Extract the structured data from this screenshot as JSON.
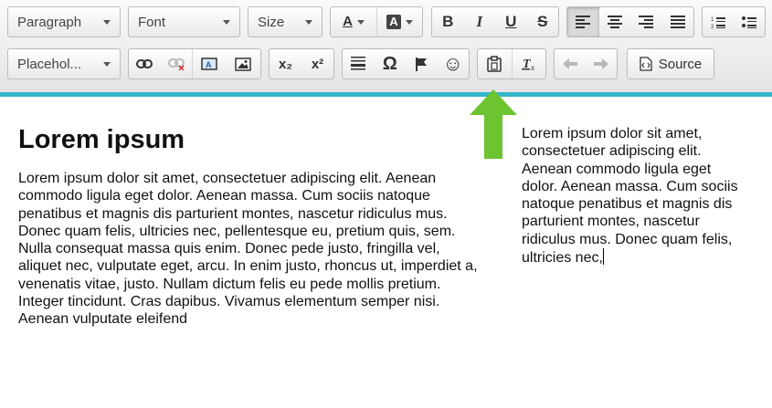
{
  "toolbar": {
    "paragraph_label": "Paragraph",
    "font_label": "Font",
    "size_label": "Size",
    "placeholder_label": "Placehol...",
    "source_label": "Source",
    "text_color_glyph": "A",
    "bg_color_glyph": "A",
    "bold_glyph": "B",
    "italic_glyph": "I",
    "underline_glyph": "U",
    "strike_glyph": "S",
    "omega_glyph": "Ω",
    "smiley_glyph": "☺",
    "subscript_glyph": "x₂",
    "superscript_glyph": "x²",
    "text_color": "#c0392b",
    "bg_color": "#444444",
    "accent": "#33b5cc"
  },
  "editor": {
    "heading": "Lorem ipsum",
    "paragraph": "Lorem ipsum dolor sit amet, consectetuer adipiscing elit. Aenean commodo ligula eget dolor. Aenean massa. Cum sociis natoque penatibus et magnis dis parturient montes, nascetur ridiculus mus. Donec quam felis, ultricies nec, pellentesque eu, pretium quis, sem. Nulla consequat massa quis enim. Donec pede justo, fringilla vel, aliquet nec, vulputate eget, arcu. In enim justo, rhoncus ut, imperdiet a, venenatis vitae, justo. Nullam dictum felis eu pede mollis pretium. Integer tincidunt. Cras dapibus. Vivamus elementum semper nisi. Aenean vulputate eleifend",
    "side_text": "Lorem ipsum dolor sit amet, consectetuer adipiscing elit. Aenean commodo ligula eget dolor. Aenean massa. Cum sociis natoque penatibus et magnis dis parturient montes, nascetur ridiculus mus. Donec quam felis, ultricies nec,"
  },
  "annotation": {
    "arrow_color": "#6cc430"
  }
}
